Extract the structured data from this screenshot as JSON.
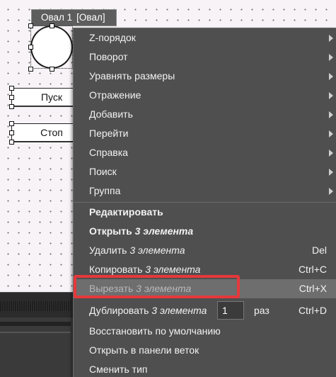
{
  "canvas": {
    "shape_label": {
      "name": "Овал 1",
      "type": "[Овал]"
    },
    "buttons": [
      {
        "label": "Пуск"
      },
      {
        "label": "Стоп"
      }
    ]
  },
  "context_menu": {
    "submenus": [
      {
        "label": "Z-порядок"
      },
      {
        "label": "Поворот"
      },
      {
        "label": "Уравнять размеры"
      },
      {
        "label": "Отражение"
      },
      {
        "label": "Добавить"
      },
      {
        "label": "Перейти"
      },
      {
        "label": "Справка"
      },
      {
        "label": "Поиск"
      },
      {
        "label": "Группа"
      }
    ],
    "edit": {
      "label": "Редактировать"
    },
    "open": {
      "label": "Открыть",
      "target": "3 элемента"
    },
    "delete": {
      "label": "Удалить",
      "target": "3 элемента",
      "shortcut": "Del"
    },
    "copy": {
      "label": "Копировать",
      "target": "3 элемента",
      "shortcut": "Ctrl+C"
    },
    "cut": {
      "label": "Вырезать",
      "target": "3 элемента",
      "shortcut": "Ctrl+X"
    },
    "duplicate": {
      "label": "Дублировать",
      "target": "3 элемента",
      "count": "1",
      "unit": "раз",
      "shortcut": "Ctrl+D"
    },
    "restore_default": {
      "label": "Восстановить по умолчанию"
    },
    "open_in_branches": {
      "label": "Открыть в панели веток"
    },
    "change_type": {
      "label": "Сменить тип"
    }
  },
  "colors": {
    "menu_bg": "#4f4f4f",
    "highlight": "#6e6e6e",
    "annotation_red": "#e5383b"
  }
}
